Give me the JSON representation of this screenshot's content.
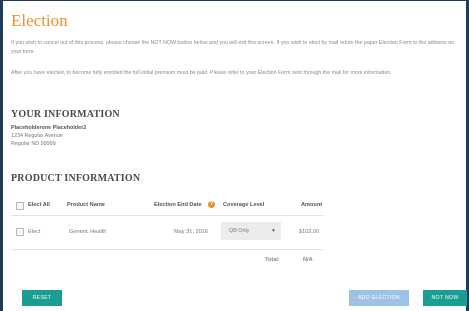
{
  "page": {
    "title": "Election",
    "paragraph1": "If you wish to cancel out of this process, please choose the NOT NOW button below and you will exit this screen. If you wish to elect by mail return the paper Election Form to the address on your form.",
    "paragraph2": "After you have elected, to become fully enrolled the full initial premium must be paid. Please refer to your Election Form sent through the mail for more information."
  },
  "your_information": {
    "heading": "YOUR INFORMATION",
    "name": "Placeholderone Placeholder2",
    "address_line1": "1234 Regular Avenue",
    "address_line2": "Regular ND 99999"
  },
  "product_information": {
    "heading": "PRODUCT INFORMATION",
    "columns": {
      "elect_all": "Elect All",
      "product_name": "Product Name",
      "election_end_date": "Election End Date",
      "coverage_level": "Coverage Level",
      "amount": "Amount"
    },
    "help_icon_glyph": "?",
    "rows": [
      {
        "elect_label": "Elect",
        "product_name": "Generic Health",
        "election_end_date": "May 31, 2016",
        "coverage_level": "QB Only",
        "amount": "$102.00"
      }
    ],
    "total_label": "Total:",
    "total_value": "N/A"
  },
  "buttons": {
    "reset": "RESET",
    "add_election": "ADD ELECTION",
    "not_now": "NOT NOW"
  },
  "colors": {
    "title": "#e8902a",
    "frame_bg": "#1f3d5a",
    "teal_button": "#1a9e94",
    "disabled_button": "#9ec1e6"
  }
}
